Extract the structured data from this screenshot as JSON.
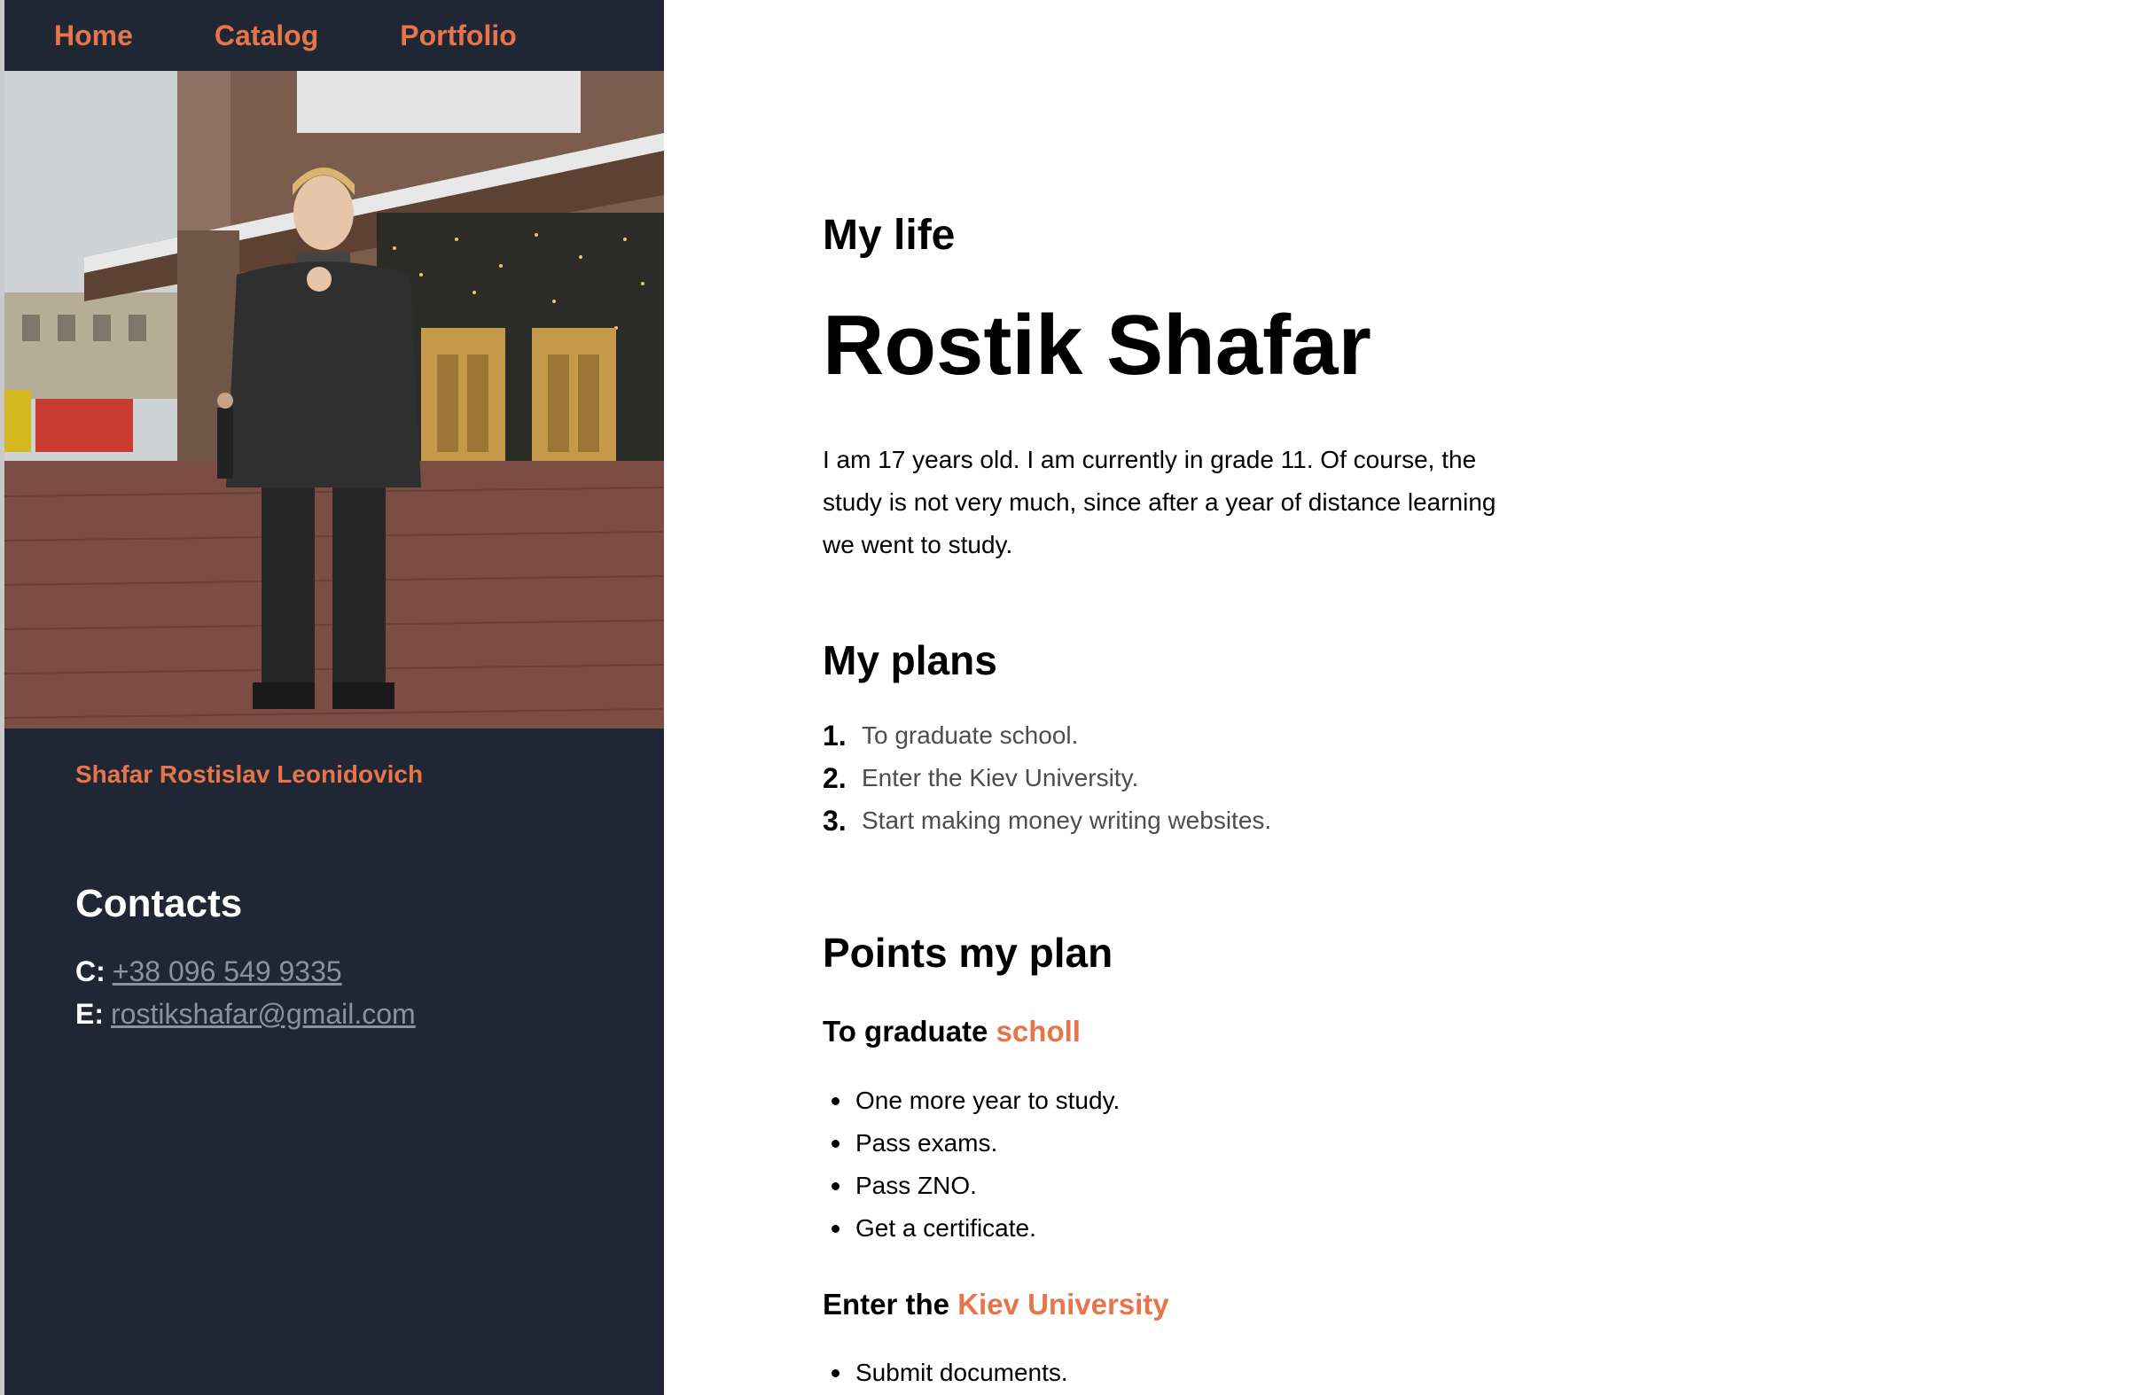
{
  "nav": {
    "items": [
      {
        "label": "Home"
      },
      {
        "label": "Catalog"
      },
      {
        "label": "Portfolio"
      }
    ]
  },
  "sidebar": {
    "photo_icon": "person-photo",
    "full_name": "Shafar Rostislav Leonidovich",
    "contacts_title": "Contacts",
    "phone_key": "C:",
    "phone": "+38 096 549 9335",
    "email_key": "E:",
    "email": "rostikshafar@gmail.com"
  },
  "main": {
    "subtitle": "My life",
    "name": "Rostik Shafar",
    "intro": "I am 17 years old. I am currently in grade 11. Of course, the study is not very much, since after a year of distance learning we went to study.",
    "plans_title": "My plans",
    "plans": [
      {
        "num": "1.",
        "text": "To graduate school."
      },
      {
        "num": "2.",
        "text": "Enter the Kiev University."
      },
      {
        "num": "3.",
        "text": "Start making money writing websites."
      }
    ],
    "points_title": "Points my plan",
    "section1": {
      "prefix": "To graduate ",
      "highlight": "scholl",
      "items": [
        "One more year to study.",
        "Pass exams.",
        "Pass ZNO.",
        "Get a certificate."
      ]
    },
    "section2": {
      "prefix": "Enter the ",
      "highlight": "Kiev University",
      "items": [
        "Submit documents."
      ]
    }
  },
  "colors": {
    "sidebar_bg": "#1f2735",
    "accent": "#e8744a",
    "link_muted": "#8a929f"
  }
}
